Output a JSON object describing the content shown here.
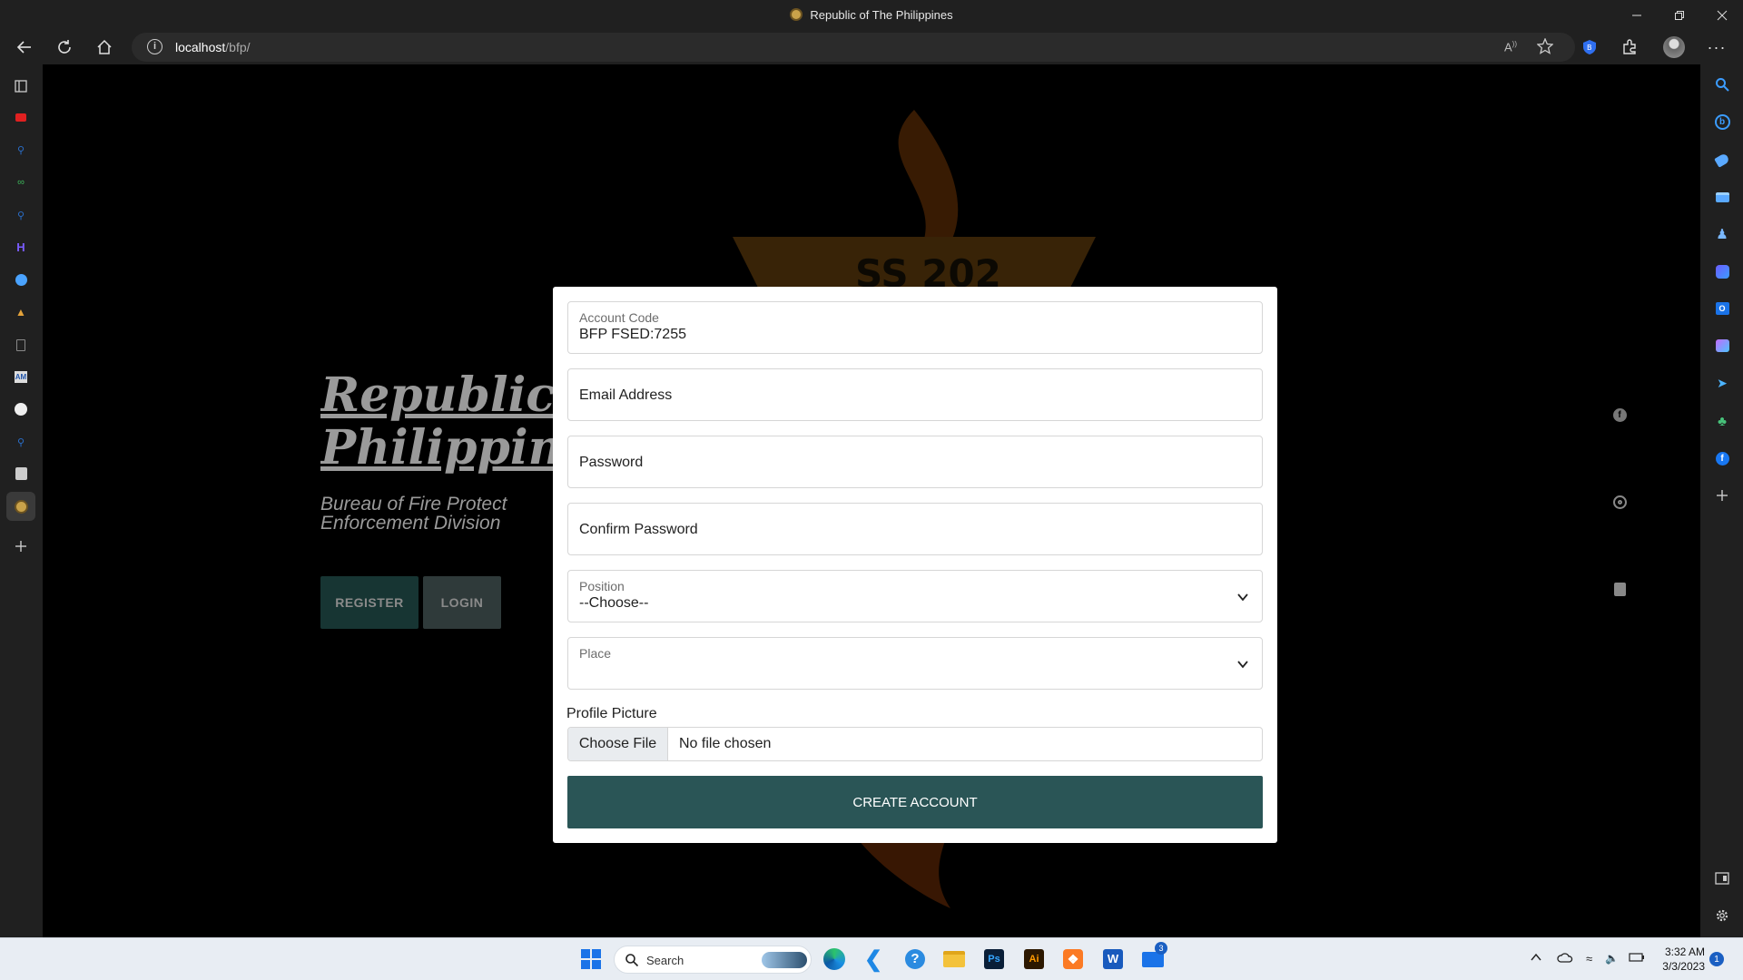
{
  "window": {
    "title": "Republic of The Philippines"
  },
  "browser": {
    "url_host": "localhost",
    "url_path": "/bfp/"
  },
  "hero": {
    "title_line1": "Republic",
    "title_line2": "Philippin",
    "subtitle_line1": "Bureau of Fire Protect",
    "subtitle_line2": "Enforcement Division",
    "register_label": "REGISTER",
    "login_label": "LOGIN"
  },
  "form": {
    "account_code": {
      "label": "Account Code",
      "value": "BFP FSED:7255"
    },
    "email": {
      "placeholder": "Email Address"
    },
    "password": {
      "placeholder": "Password"
    },
    "confirm_password": {
      "placeholder": "Confirm Password"
    },
    "position": {
      "label": "Position",
      "selected": "--Choose--"
    },
    "place": {
      "label": "Place",
      "selected": ""
    },
    "profile_picture": {
      "label": "Profile Picture",
      "choose_label": "Choose File",
      "status": "No file chosen"
    },
    "submit_label": "CREATE ACCOUNT"
  },
  "taskbar": {
    "search_placeholder": "Search",
    "time": "3:32 AM",
    "date": "3/3/2023",
    "notification_count": "1",
    "mail_badge": "3"
  },
  "colors": {
    "primary": "#2a5556",
    "register_btn": "#173533",
    "login_btn": "#2f3a3a",
    "page_background": "#000000",
    "browser_chrome": "#202020"
  }
}
